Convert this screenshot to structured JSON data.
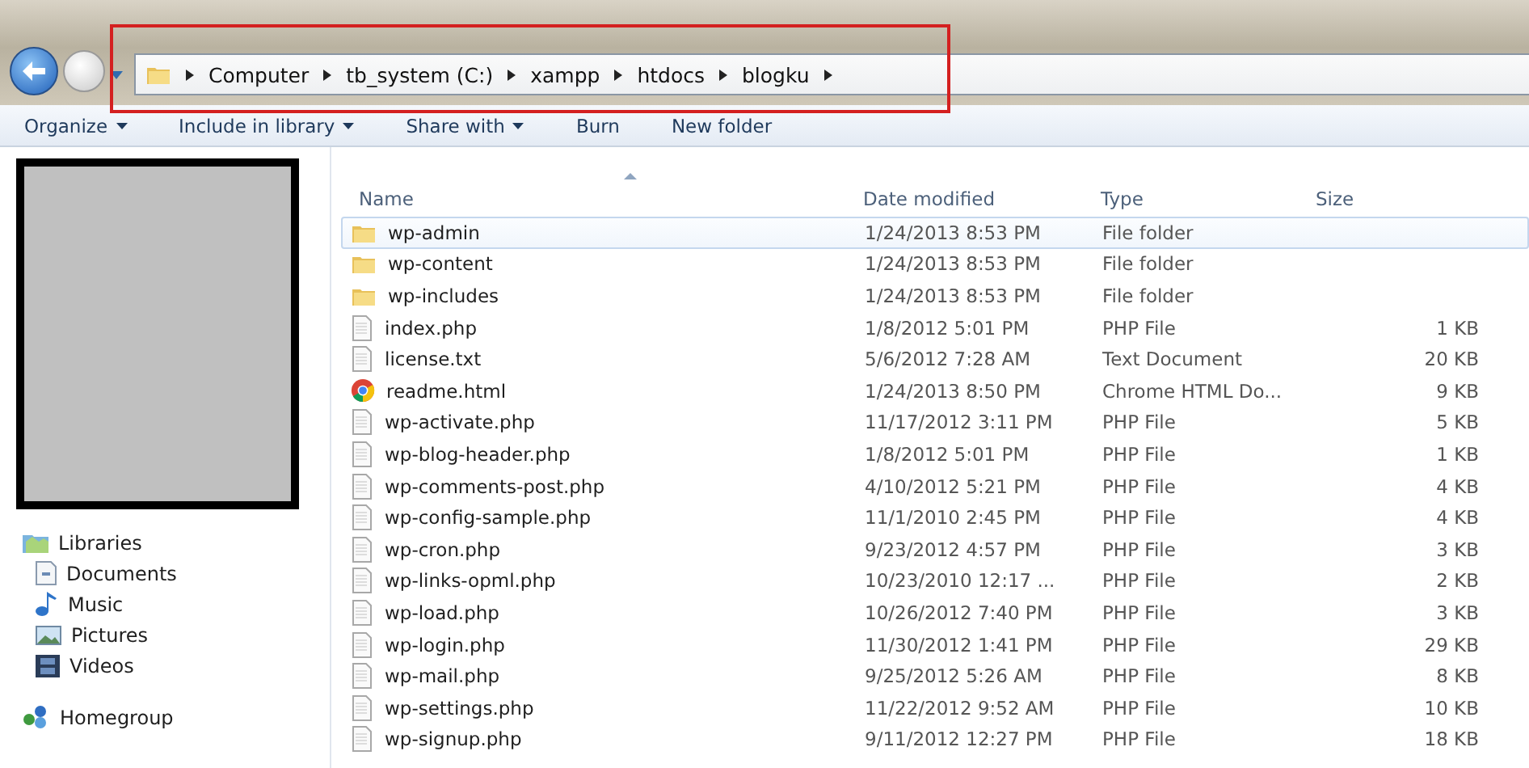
{
  "breadcrumbs": [
    "Computer",
    "tb_system (C:)",
    "xampp",
    "htdocs",
    "blogku"
  ],
  "toolbar": [
    {
      "label": "Organize",
      "dropdown": true
    },
    {
      "label": "Include in library",
      "dropdown": true
    },
    {
      "label": "Share with",
      "dropdown": true
    },
    {
      "label": "Burn",
      "dropdown": false
    },
    {
      "label": "New folder",
      "dropdown": false
    }
  ],
  "sidebar": {
    "items": [
      {
        "label": "Libraries",
        "kind": "libraries",
        "children": [
          {
            "label": "Documents",
            "kind": "documents"
          },
          {
            "label": "Music",
            "kind": "music"
          },
          {
            "label": "Pictures",
            "kind": "pictures"
          },
          {
            "label": "Videos",
            "kind": "videos"
          }
        ]
      },
      {
        "label": "Homegroup",
        "kind": "homegroup"
      }
    ]
  },
  "table": {
    "columns": [
      "Name",
      "Date modified",
      "Type",
      "Size"
    ],
    "rows": [
      {
        "name": "wp-admin",
        "date": "1/24/2013 8:53 PM",
        "type": "File folder",
        "kind": "folder",
        "selected": true
      },
      {
        "name": "wp-content",
        "date": "1/24/2013 8:53 PM",
        "type": "File folder",
        "kind": "folder",
        "selected": false
      },
      {
        "name": "wp-includes",
        "date": "1/24/2013 8:53 PM",
        "type": "File folder",
        "kind": "folder",
        "selected": false
      },
      {
        "name": "index.php",
        "date": "1/8/2012 5:01 PM",
        "type": "PHP File",
        "size": "1 KB",
        "kind": "file",
        "selected": false
      },
      {
        "name": "license.txt",
        "date": "5/6/2012 7:28 AM",
        "type": "Text Document",
        "size": "20 KB",
        "kind": "file",
        "selected": false
      },
      {
        "name": "readme.html",
        "date": "1/24/2013 8:50 PM",
        "type": "Chrome HTML Do...",
        "size": "9 KB",
        "kind": "chrome",
        "selected": false
      },
      {
        "name": "wp-activate.php",
        "date": "11/17/2012 3:11 PM",
        "type": "PHP File",
        "size": "5 KB",
        "kind": "file",
        "selected": false
      },
      {
        "name": "wp-blog-header.php",
        "date": "1/8/2012 5:01 PM",
        "type": "PHP File",
        "size": "1 KB",
        "kind": "file",
        "selected": false
      },
      {
        "name": "wp-comments-post.php",
        "date": "4/10/2012 5:21 PM",
        "type": "PHP File",
        "size": "4 KB",
        "kind": "file",
        "selected": false
      },
      {
        "name": "wp-config-sample.php",
        "date": "11/1/2010 2:45 PM",
        "type": "PHP File",
        "size": "4 KB",
        "kind": "file",
        "selected": false
      },
      {
        "name": "wp-cron.php",
        "date": "9/23/2012 4:57 PM",
        "type": "PHP File",
        "size": "3 KB",
        "kind": "file",
        "selected": false
      },
      {
        "name": "wp-links-opml.php",
        "date": "10/23/2010 12:17 ...",
        "type": "PHP File",
        "size": "2 KB",
        "kind": "file",
        "selected": false
      },
      {
        "name": "wp-load.php",
        "date": "10/26/2012 7:40 PM",
        "type": "PHP File",
        "size": "3 KB",
        "kind": "file",
        "selected": false
      },
      {
        "name": "wp-login.php",
        "date": "11/30/2012 1:41 PM",
        "type": "PHP File",
        "size": "29 KB",
        "kind": "file",
        "selected": false
      },
      {
        "name": "wp-mail.php",
        "date": "9/25/2012 5:26 AM",
        "type": "PHP File",
        "size": "8 KB",
        "kind": "file",
        "selected": false
      },
      {
        "name": "wp-settings.php",
        "date": "11/22/2012 9:52 AM",
        "type": "PHP File",
        "size": "10 KB",
        "kind": "file",
        "selected": false
      },
      {
        "name": "wp-signup.php",
        "date": "9/11/2012 12:27 PM",
        "type": "PHP File",
        "size": "18 KB",
        "kind": "file",
        "selected": false
      }
    ]
  }
}
